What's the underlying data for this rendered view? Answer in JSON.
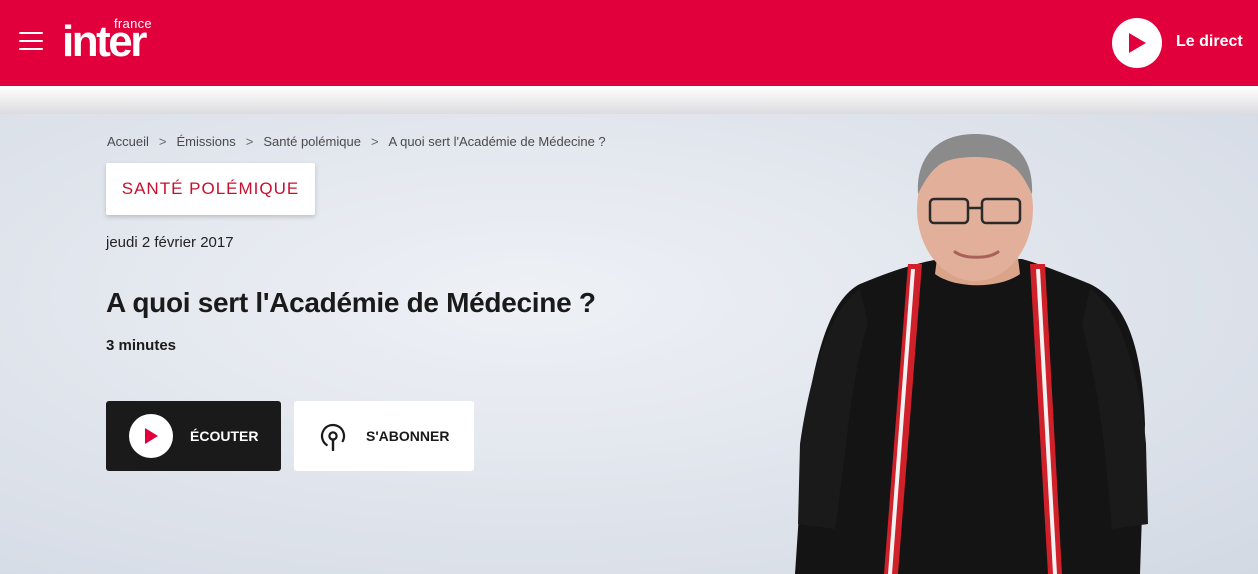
{
  "header": {
    "logo_small": "france",
    "logo_main": "inter",
    "live_label": "Le direct",
    "brand_color": "#e1003c"
  },
  "breadcrumb": {
    "items": [
      "Accueil",
      "Émissions",
      "Santé polémique",
      "A quoi sert l'Académie de Médecine ?"
    ],
    "separator": ">"
  },
  "episode": {
    "show_tag": "SANTÉ POLÉMIQUE",
    "date": "jeudi 2 février 2017",
    "title": "A quoi sert l'Académie de Médecine ?",
    "duration": "3 minutes"
  },
  "actions": {
    "listen_label": "ÉCOUTER",
    "subscribe_label": "S'ABONNER"
  },
  "icons": {
    "menu": "hamburger-icon",
    "live_play": "play-icon",
    "listen_play": "play-icon",
    "subscribe": "podcast-icon",
    "breadcrumb_sep": "chevron-right-icon"
  }
}
